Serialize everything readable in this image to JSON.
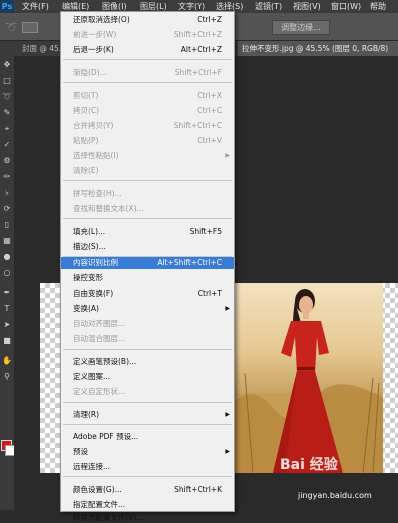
{
  "menubar": {
    "items": [
      "文件(F)",
      "编辑(E)",
      "图像(I)",
      "图层(L)",
      "文字(Y)",
      "选择(S)",
      "滤镜(T)",
      "视图(V)",
      "窗口(W)",
      "帮助"
    ]
  },
  "optbar": {
    "adjust_edge": "调整边缘..."
  },
  "tabs": {
    "left": "封面 @ 45.5...",
    "active": "拉伸不变形.jpg @ 45.5% (图层 0, RGB/8)"
  },
  "edit_menu": {
    "items": [
      {
        "label": "还原取消选择(O)",
        "shortcut": "Ctrl+Z",
        "disabled": false
      },
      {
        "label": "前进一步(W)",
        "shortcut": "Shift+Ctrl+Z",
        "disabled": true
      },
      {
        "label": "后退一步(K)",
        "shortcut": "Alt+Ctrl+Z",
        "disabled": false
      },
      {
        "label": "渐隐(D)...",
        "shortcut": "Shift+Ctrl+F",
        "disabled": true
      },
      {
        "label": "剪切(T)",
        "shortcut": "Ctrl+X",
        "disabled": true
      },
      {
        "label": "拷贝(C)",
        "shortcut": "Ctrl+C",
        "disabled": true
      },
      {
        "label": "合并拷贝(Y)",
        "shortcut": "Shift+Ctrl+C",
        "disabled": true
      },
      {
        "label": "粘贴(P)",
        "shortcut": "Ctrl+V",
        "disabled": true
      },
      {
        "label": "选择性粘贴(I)",
        "shortcut": "",
        "disabled": true,
        "submenu": true
      },
      {
        "label": "清除(E)",
        "shortcut": "",
        "disabled": true
      },
      {
        "label": "拼写检查(H)...",
        "shortcut": "",
        "disabled": true
      },
      {
        "label": "查找和替换文本(X)...",
        "shortcut": "",
        "disabled": true
      },
      {
        "label": "填充(L)...",
        "shortcut": "Shift+F5",
        "disabled": false
      },
      {
        "label": "描边(S)...",
        "shortcut": "",
        "disabled": false
      },
      {
        "label": "内容识别比例",
        "shortcut": "Alt+Shift+Ctrl+C",
        "disabled": false,
        "highlighted": true
      },
      {
        "label": "操控变形",
        "shortcut": "",
        "disabled": false
      },
      {
        "label": "自由变换(F)",
        "shortcut": "Ctrl+T",
        "disabled": false
      },
      {
        "label": "变换(A)",
        "shortcut": "",
        "disabled": false,
        "submenu": true
      },
      {
        "label": "自动对齐图层...",
        "shortcut": "",
        "disabled": true
      },
      {
        "label": "自动混合图层...",
        "shortcut": "",
        "disabled": true
      },
      {
        "label": "定义画笔预设(B)...",
        "shortcut": "",
        "disabled": false
      },
      {
        "label": "定义图案...",
        "shortcut": "",
        "disabled": false
      },
      {
        "label": "定义自定形状...",
        "shortcut": "",
        "disabled": true
      },
      {
        "label": "清理(R)",
        "shortcut": "",
        "disabled": false,
        "submenu": true
      },
      {
        "label": "Adobe PDF 预设...",
        "shortcut": "",
        "disabled": false
      },
      {
        "label": "预设",
        "shortcut": "",
        "disabled": false,
        "submenu": true
      },
      {
        "label": "远程连接...",
        "shortcut": "",
        "disabled": false
      },
      {
        "label": "颜色设置(G)...",
        "shortcut": "Shift+Ctrl+K",
        "disabled": false
      },
      {
        "label": "指定配置文件...",
        "shortcut": "",
        "disabled": false
      },
      {
        "label": "转换为配置文件(V)...",
        "shortcut": "",
        "disabled": false
      }
    ]
  },
  "watermark": {
    "brand": "Bai 经验",
    "url": "jingyan.baidu.com"
  },
  "colors": {
    "accent": "#3a7bd5",
    "dress": "#c8241c",
    "foreground": "#d01a1a"
  }
}
